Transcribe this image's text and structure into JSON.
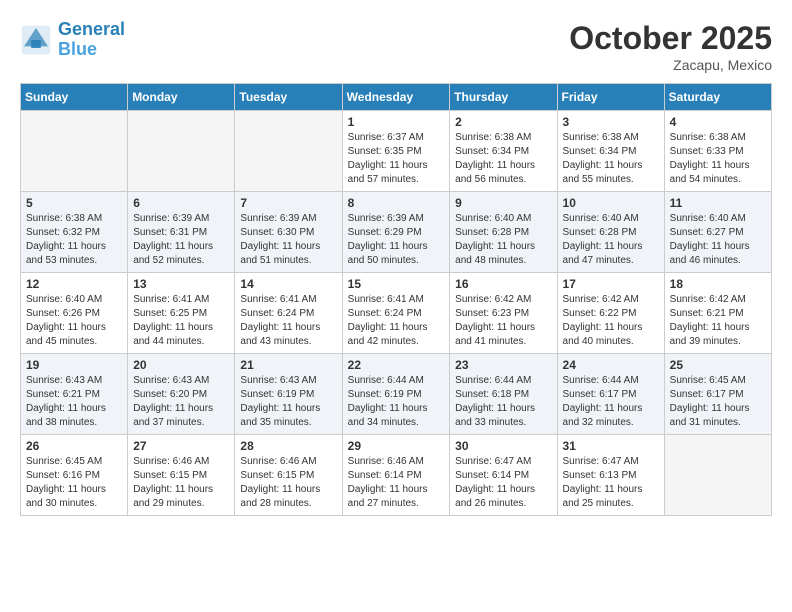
{
  "header": {
    "logo_line1": "General",
    "logo_line2": "Blue",
    "month": "October 2025",
    "location": "Zacapu, Mexico"
  },
  "days_of_week": [
    "Sunday",
    "Monday",
    "Tuesday",
    "Wednesday",
    "Thursday",
    "Friday",
    "Saturday"
  ],
  "weeks": [
    [
      {
        "day": "",
        "info": ""
      },
      {
        "day": "",
        "info": ""
      },
      {
        "day": "",
        "info": ""
      },
      {
        "day": "1",
        "info": "Sunrise: 6:37 AM\nSunset: 6:35 PM\nDaylight: 11 hours\nand 57 minutes."
      },
      {
        "day": "2",
        "info": "Sunrise: 6:38 AM\nSunset: 6:34 PM\nDaylight: 11 hours\nand 56 minutes."
      },
      {
        "day": "3",
        "info": "Sunrise: 6:38 AM\nSunset: 6:34 PM\nDaylight: 11 hours\nand 55 minutes."
      },
      {
        "day": "4",
        "info": "Sunrise: 6:38 AM\nSunset: 6:33 PM\nDaylight: 11 hours\nand 54 minutes."
      }
    ],
    [
      {
        "day": "5",
        "info": "Sunrise: 6:38 AM\nSunset: 6:32 PM\nDaylight: 11 hours\nand 53 minutes."
      },
      {
        "day": "6",
        "info": "Sunrise: 6:39 AM\nSunset: 6:31 PM\nDaylight: 11 hours\nand 52 minutes."
      },
      {
        "day": "7",
        "info": "Sunrise: 6:39 AM\nSunset: 6:30 PM\nDaylight: 11 hours\nand 51 minutes."
      },
      {
        "day": "8",
        "info": "Sunrise: 6:39 AM\nSunset: 6:29 PM\nDaylight: 11 hours\nand 50 minutes."
      },
      {
        "day": "9",
        "info": "Sunrise: 6:40 AM\nSunset: 6:28 PM\nDaylight: 11 hours\nand 48 minutes."
      },
      {
        "day": "10",
        "info": "Sunrise: 6:40 AM\nSunset: 6:28 PM\nDaylight: 11 hours\nand 47 minutes."
      },
      {
        "day": "11",
        "info": "Sunrise: 6:40 AM\nSunset: 6:27 PM\nDaylight: 11 hours\nand 46 minutes."
      }
    ],
    [
      {
        "day": "12",
        "info": "Sunrise: 6:40 AM\nSunset: 6:26 PM\nDaylight: 11 hours\nand 45 minutes."
      },
      {
        "day": "13",
        "info": "Sunrise: 6:41 AM\nSunset: 6:25 PM\nDaylight: 11 hours\nand 44 minutes."
      },
      {
        "day": "14",
        "info": "Sunrise: 6:41 AM\nSunset: 6:24 PM\nDaylight: 11 hours\nand 43 minutes."
      },
      {
        "day": "15",
        "info": "Sunrise: 6:41 AM\nSunset: 6:24 PM\nDaylight: 11 hours\nand 42 minutes."
      },
      {
        "day": "16",
        "info": "Sunrise: 6:42 AM\nSunset: 6:23 PM\nDaylight: 11 hours\nand 41 minutes."
      },
      {
        "day": "17",
        "info": "Sunrise: 6:42 AM\nSunset: 6:22 PM\nDaylight: 11 hours\nand 40 minutes."
      },
      {
        "day": "18",
        "info": "Sunrise: 6:42 AM\nSunset: 6:21 PM\nDaylight: 11 hours\nand 39 minutes."
      }
    ],
    [
      {
        "day": "19",
        "info": "Sunrise: 6:43 AM\nSunset: 6:21 PM\nDaylight: 11 hours\nand 38 minutes."
      },
      {
        "day": "20",
        "info": "Sunrise: 6:43 AM\nSunset: 6:20 PM\nDaylight: 11 hours\nand 37 minutes."
      },
      {
        "day": "21",
        "info": "Sunrise: 6:43 AM\nSunset: 6:19 PM\nDaylight: 11 hours\nand 35 minutes."
      },
      {
        "day": "22",
        "info": "Sunrise: 6:44 AM\nSunset: 6:19 PM\nDaylight: 11 hours\nand 34 minutes."
      },
      {
        "day": "23",
        "info": "Sunrise: 6:44 AM\nSunset: 6:18 PM\nDaylight: 11 hours\nand 33 minutes."
      },
      {
        "day": "24",
        "info": "Sunrise: 6:44 AM\nSunset: 6:17 PM\nDaylight: 11 hours\nand 32 minutes."
      },
      {
        "day": "25",
        "info": "Sunrise: 6:45 AM\nSunset: 6:17 PM\nDaylight: 11 hours\nand 31 minutes."
      }
    ],
    [
      {
        "day": "26",
        "info": "Sunrise: 6:45 AM\nSunset: 6:16 PM\nDaylight: 11 hours\nand 30 minutes."
      },
      {
        "day": "27",
        "info": "Sunrise: 6:46 AM\nSunset: 6:15 PM\nDaylight: 11 hours\nand 29 minutes."
      },
      {
        "day": "28",
        "info": "Sunrise: 6:46 AM\nSunset: 6:15 PM\nDaylight: 11 hours\nand 28 minutes."
      },
      {
        "day": "29",
        "info": "Sunrise: 6:46 AM\nSunset: 6:14 PM\nDaylight: 11 hours\nand 27 minutes."
      },
      {
        "day": "30",
        "info": "Sunrise: 6:47 AM\nSunset: 6:14 PM\nDaylight: 11 hours\nand 26 minutes."
      },
      {
        "day": "31",
        "info": "Sunrise: 6:47 AM\nSunset: 6:13 PM\nDaylight: 11 hours\nand 25 minutes."
      },
      {
        "day": "",
        "info": ""
      }
    ]
  ]
}
